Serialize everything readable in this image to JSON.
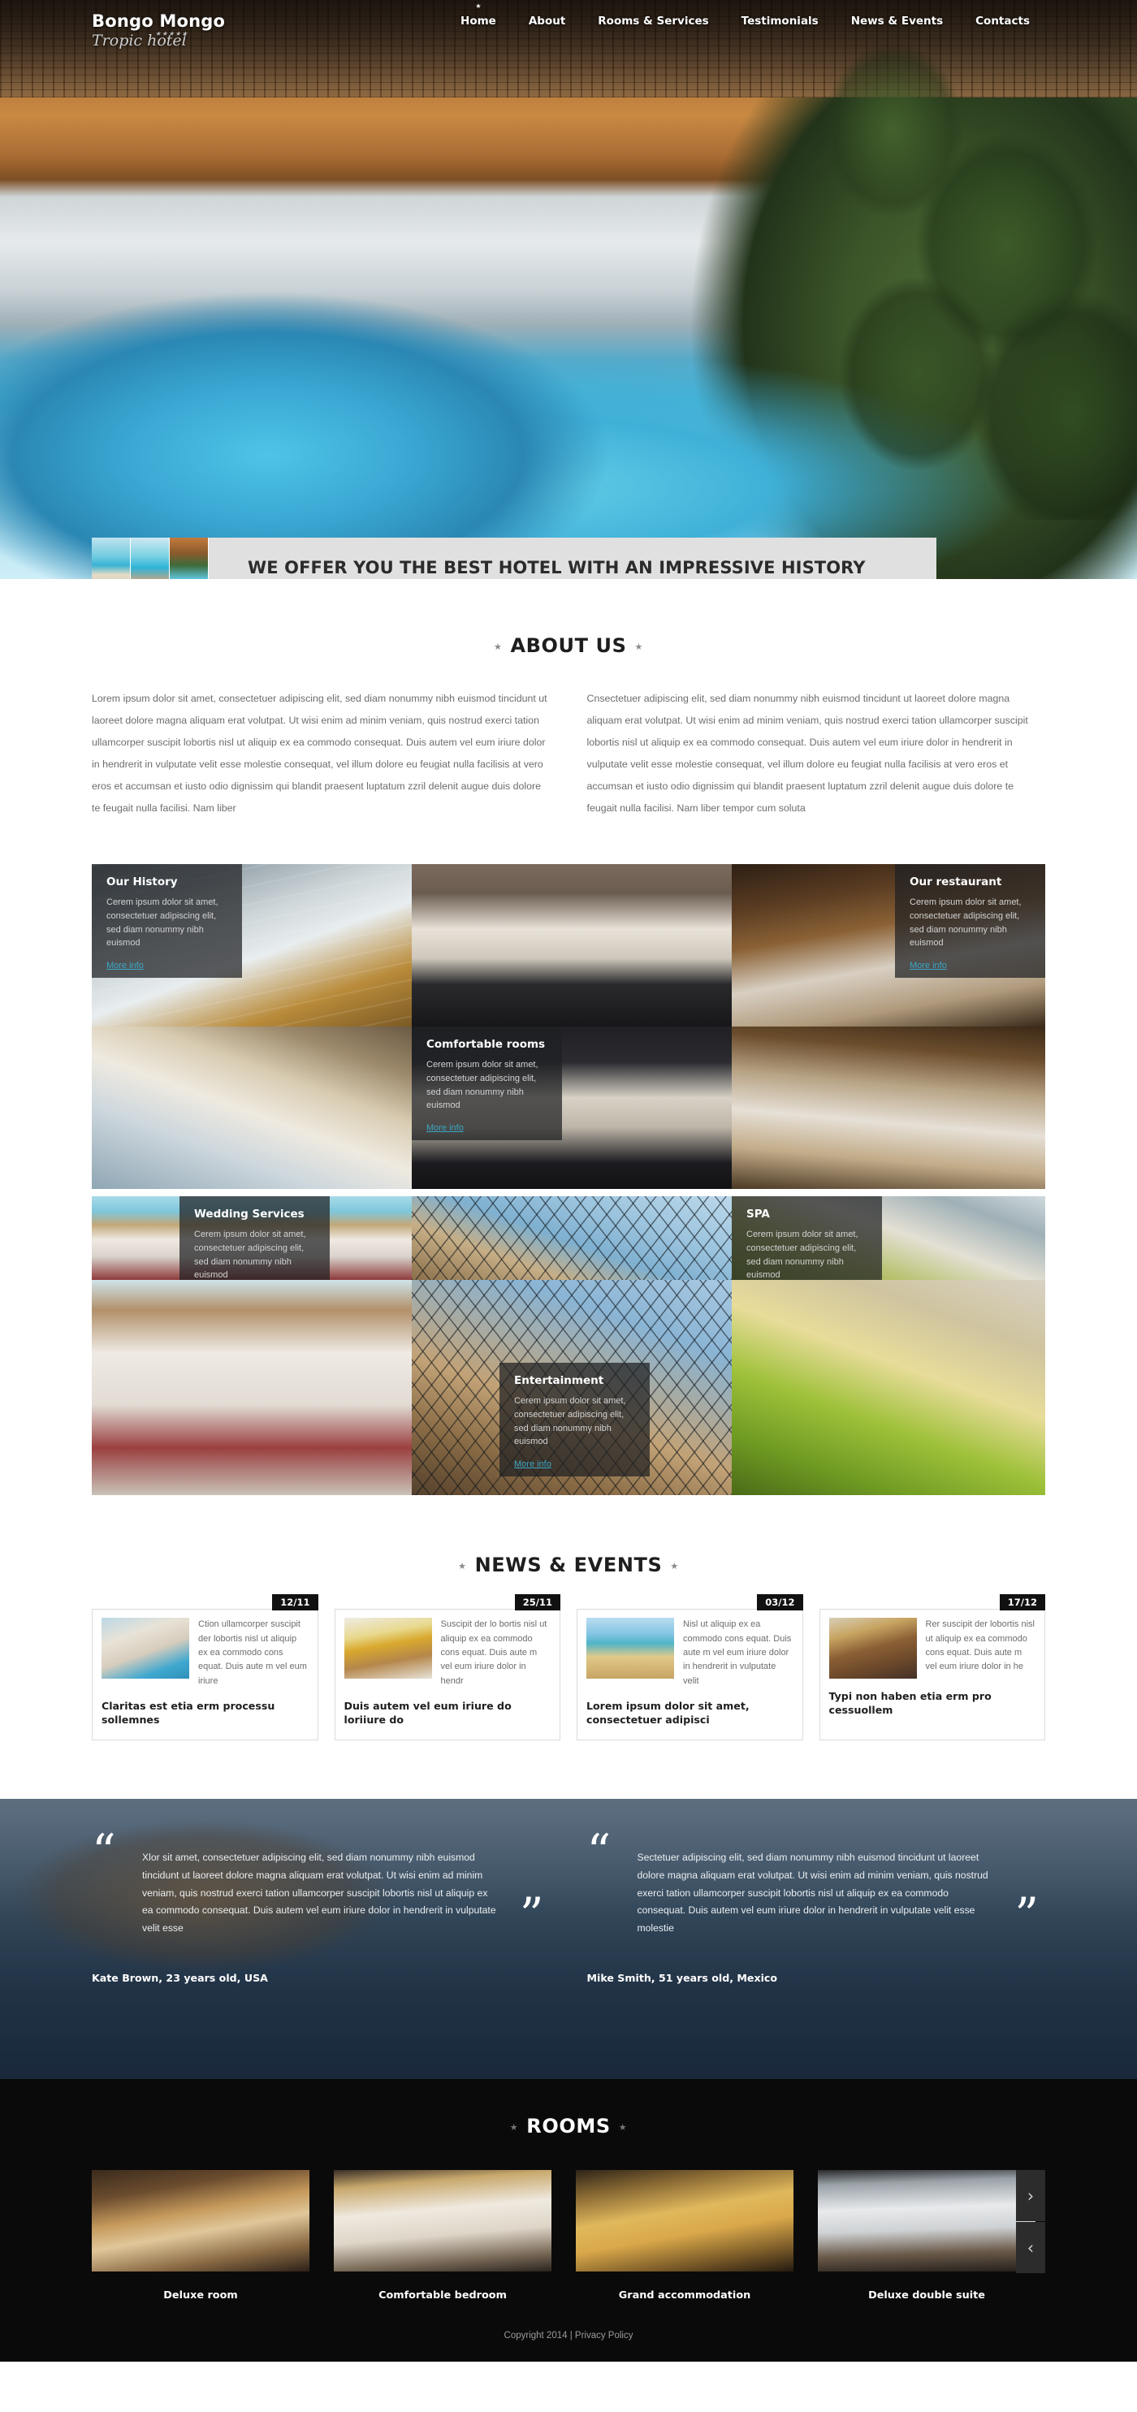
{
  "header": {
    "brand_name": "Bongo Mongo",
    "brand_sub": "Tropic hotel",
    "brand_stars": "★★★★★",
    "nav": [
      {
        "label": "Home",
        "active": true
      },
      {
        "label": "About",
        "active": false
      },
      {
        "label": "Rooms & Services",
        "active": false
      },
      {
        "label": "Testimonials",
        "active": false
      },
      {
        "label": "News & Events",
        "active": false
      },
      {
        "label": "Contacts",
        "active": false
      }
    ]
  },
  "hero": {
    "caption": "WE OFFER YOU THE BEST HOTEL WITH AN IMPRESSIVE HISTORY",
    "thumbnails": [
      "beach-lounge-thumb",
      "pier-over-water-thumb",
      "villa-pool-thumb"
    ]
  },
  "about": {
    "title": "ABOUT US",
    "star": "★",
    "col_left": "Lorem ipsum dolor sit amet, consectetuer adipiscing elit, sed diam nonummy nibh euismod tincidunt ut laoreet dolore magna aliquam erat volutpat. Ut wisi enim ad minim veniam, quis nostrud exerci tation ullamcorper suscipit lobortis nisl ut aliquip ex ea commodo consequat. Duis autem vel eum iriure dolor in hendrerit in vulputate velit esse molestie consequat, vel illum dolore eu feugiat nulla facilisis at vero eros et accumsan et iusto odio dignissim qui blandit praesent luptatum zzril delenit augue duis dolore te feugait nulla facilisi. Nam liber",
    "col_right": "Cnsectetuer adipiscing elit, sed diam nonummy nibh euismod tincidunt ut laoreet dolore magna aliquam erat volutpat. Ut wisi enim ad minim veniam, quis nostrud exerci tation ullamcorper suscipit lobortis nisl ut aliquip ex ea commodo consequat. Duis autem vel eum iriure dolor in hendrerit in vulputate velit esse molestie consequat, vel illum dolore eu feugiat nulla facilisis at vero eros et accumsan et iusto odio dignissim qui blandit praesent luptatum zzril delenit augue duis dolore te feugait nulla facilisi. Nam liber tempor cum soluta"
  },
  "services": {
    "body_text": "Cerem ipsum dolor sit amet, consectetuer adipiscing elit, sed diam nonummy nibh euismod",
    "more_label": "More info",
    "tiles": [
      {
        "title": "Our History",
        "image": "hotel-lobby-interior"
      },
      {
        "title": "Comfortable rooms",
        "image": "hotel-bedroom"
      },
      {
        "title": "Our restaurant",
        "image": "restaurant-table-setting"
      },
      {
        "title": "Wedding Services",
        "image": "beach-wedding-aisle"
      },
      {
        "title": "Entertainment",
        "image": "beach-hammock-net"
      },
      {
        "title": "SPA",
        "image": "spa-oils-and-limes"
      }
    ]
  },
  "news": {
    "title": "NEWS & EVENTS",
    "star": "★",
    "items": [
      {
        "date": "12/11",
        "excerpt": "Ction ullamcorper suscipit der lobortis nisl ut aliquip ex ea commodo cons equat. Duis aute m vel eum iriure",
        "title": "Claritas est etia erm processu sollemnes",
        "image": "hotel-pool-balconies"
      },
      {
        "date": "25/11",
        "excerpt": "Suscipit der lo bortis nisl ut aliquip ex ea commodo cons equat. Duis aute m vel eum iriure dolor in hendr",
        "title": "Duis autem vel eum iriure do loriiure do",
        "image": "breakfast-tray-coffee"
      },
      {
        "date": "03/12",
        "excerpt": "Nisl ut aliquip ex ea commodo cons equat. Duis aute m vel eum iriure dolor in hendrerit in vulputate velit",
        "title": "Lorem ipsum dolor sit amet, consectetuer adipisci",
        "image": "couple-on-beach"
      },
      {
        "date": "17/12",
        "excerpt": "Rer suscipit der lobortis nisl ut aliquip ex ea commodo cons equat. Duis aute m vel eum iriure dolor in he",
        "title": "Typi non haben etia erm pro cessuollem",
        "image": "lounge-sofas"
      }
    ]
  },
  "testimonials": {
    "quote_open": "“",
    "quote_close": "”",
    "items": [
      {
        "text": "Xlor sit amet, consectetuer adipiscing elit, sed diam nonummy nibh euismod tincidunt ut laoreet dolore magna aliquam erat volutpat. Ut wisi enim ad minim veniam, quis nostrud exerci tation ullamcorper suscipit lobortis nisl ut aliquip ex ea commodo consequat. Duis autem vel eum iriure dolor in hendrerit in vulputate velit esse",
        "author": "Kate  Brown, 23 years old, USA"
      },
      {
        "text": "Sectetuer adipiscing elit, sed diam nonummy nibh euismod tincidunt ut laoreet dolore magna aliquam erat volutpat. Ut wisi enim ad minim veniam, quis nostrud exerci tation ullamcorper suscipit lobortis nisl ut aliquip ex ea commodo consequat. Duis autem vel eum iriure dolor in hendrerit in vulputate velit esse molestie",
        "author": "Mike  Smith, 51 years old, Mexico"
      }
    ]
  },
  "rooms": {
    "title": "ROOMS",
    "star": "★",
    "items": [
      {
        "name": "Deluxe room",
        "image": "deluxe-room-photo"
      },
      {
        "name": "Comfortable bedroom",
        "image": "comfortable-bedroom-photo"
      },
      {
        "name": "Grand accommodation",
        "image": "grand-accommodation-photo"
      },
      {
        "name": "Deluxe double suite",
        "image": "deluxe-double-suite-photo"
      }
    ],
    "next_arrow": "›",
    "prev_arrow": "‹"
  },
  "footer": {
    "copyright": "Copyright 2014  |",
    "privacy": "Privacy Policy"
  },
  "colors": {
    "accent_link": "#3ba6c4",
    "caption_bg": "#e0e0e0",
    "dark_bg": "#0a0a0a",
    "badge_bg": "#111111"
  }
}
